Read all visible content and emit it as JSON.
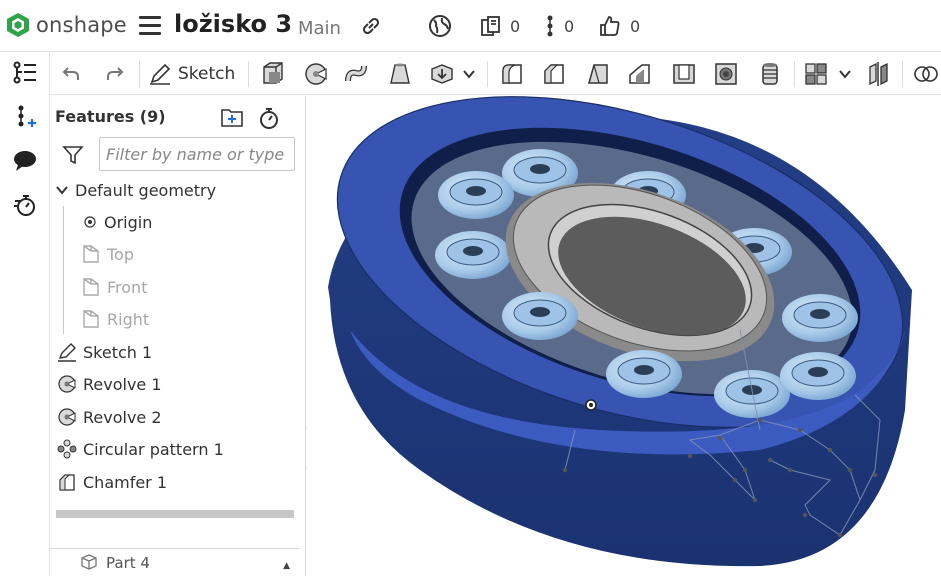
{
  "app": {
    "brand": "onshape",
    "brand_color": "#2ea34a"
  },
  "document": {
    "title": "ložisko 3",
    "workspace": "Main"
  },
  "topbar": {
    "versions_count": "0",
    "branches_count": "0",
    "likes_count": "0"
  },
  "toolbar": {
    "sketch_label": "Sketch"
  },
  "features": {
    "title": "Features (9)",
    "filter_placeholder": "Filter by name or type",
    "default_geometry": "Default geometry",
    "origin": "Origin",
    "planes": [
      "Top",
      "Front",
      "Right"
    ],
    "items": [
      "Sketch 1",
      "Revolve 1",
      "Revolve 2",
      "Circular pattern 1",
      "Chamfer 1"
    ],
    "parts_row": "Part 4"
  },
  "icons": [
    "onshape-logo-icon",
    "menu-icon",
    "link-icon",
    "globe-icon",
    "versions-icon",
    "branch-icon",
    "like-icon",
    "undo-icon",
    "redo-icon",
    "pencil-icon",
    "extrude-icon",
    "revolve-icon",
    "sweep-icon",
    "loft-icon",
    "thicken-icon",
    "fillet-icon",
    "chamfer-icon",
    "draft-icon",
    "rib-icon",
    "shell-icon",
    "hole-icon",
    "thread-icon",
    "pattern-icon",
    "boolean-icon",
    "filter-icon",
    "folder-add-icon",
    "rollback-icon",
    "feature-list-icon",
    "insert-icon",
    "comment-icon",
    "history-icon"
  ],
  "colors": {
    "outer_ring": "#2f4a9e",
    "ball": "#8fb7df",
    "inner_ring": "#b0b0b0"
  }
}
